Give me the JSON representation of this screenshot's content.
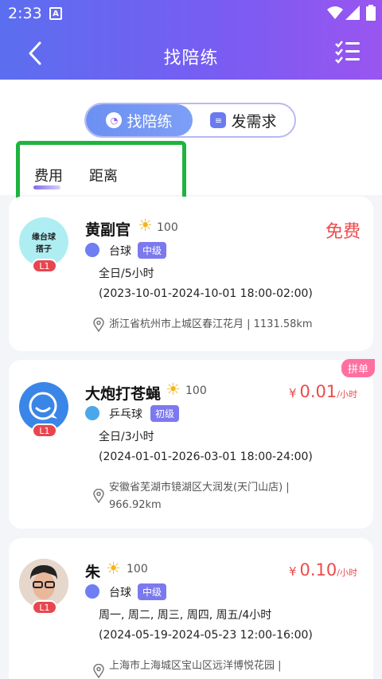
{
  "status_bar": {
    "time": "2:33",
    "app_letter": "A"
  },
  "header": {
    "title": "找陪练"
  },
  "segment": {
    "find_label": "找陪练",
    "post_label": "发需求"
  },
  "sort": {
    "fee_label": "费用",
    "distance_label": "距离"
  },
  "coaches": [
    {
      "name": "黄副官",
      "score": "100",
      "price_text": "免费",
      "sport": "台球",
      "level": "中级",
      "avatar_text_1": "缘台球",
      "avatar_text_2": "搭子",
      "level_badge": "L1",
      "availability": "全日/5小时",
      "period": "(2023-10-01-2024-10-01 18:00-02:00)",
      "location": "浙江省杭州市上城区春江花月 | 1131.58km"
    },
    {
      "name": "大炮打苍蝇",
      "score": "100",
      "tag": "拼单",
      "currency": "¥",
      "price": "0.01",
      "price_unit": "/小时",
      "sport": "乒乓球",
      "level": "初级",
      "level_badge": "L1",
      "availability": "全日/3小时",
      "period": "(2024-01-01-2026-03-01 18:00-24:00)",
      "location_line1": "安徽省芜湖市镜湖区大润发(天门山店) |",
      "location_line2": "966.92km"
    },
    {
      "name": "朱",
      "score": "100",
      "currency": "¥",
      "price": "0.10",
      "price_unit": "/小时",
      "sport": "台球",
      "level": "中级",
      "level_badge": "L1",
      "availability": "周一, 周二, 周三, 周四, 周五/4小时",
      "period": "(2024-05-19-2024-05-23 12:00-16:00)",
      "location_line1": "上海市上海城区宝山区远洋博悦花园 |"
    }
  ],
  "colors": {
    "header_start": "#5b6ef0",
    "header_end": "#9a55f0",
    "price": "#ee4a4a",
    "level_tag": "#7c79ef",
    "highlight_box": "#1fb33f"
  },
  "icons": [
    "back-icon",
    "menu-list-icon",
    "wifi-icon",
    "signal-icon",
    "battery-icon",
    "sun-icon",
    "billiards-icon",
    "ping-pong-icon",
    "location-pin-icon"
  ]
}
